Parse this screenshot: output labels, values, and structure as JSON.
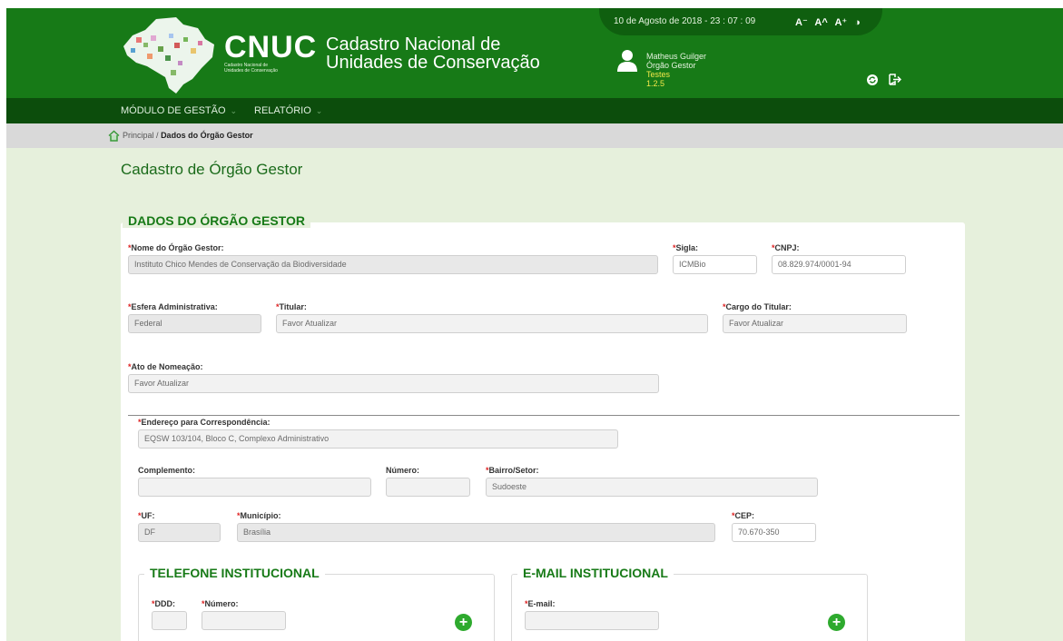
{
  "header": {
    "logo_text": "CNUC",
    "logo_subtitle_1": "Cadastro Nacional de",
    "logo_subtitle_2": "Unidades de Conservação",
    "app_title_line1": "Cadastro Nacional de",
    "app_title_line2": "Unidades de Conservação",
    "datetime": "10 de Agosto de 2018 - 23 : 07 : 09",
    "font_controls": [
      "A⁻",
      "A^",
      "A⁺",
      "◑"
    ],
    "user": {
      "name": "Matheus Guilger",
      "role": "Órgão Gestor",
      "env": "Testes",
      "version": "1.2.5"
    },
    "icons": {
      "refresh": "refresh-icon",
      "logout": "logout-icon",
      "user": "user-icon",
      "home": "home-icon"
    }
  },
  "menu": {
    "items": [
      "MÓDULO DE GESTÃO",
      "RELATÓRIO"
    ]
  },
  "breadcrumb": {
    "home": "Principal",
    "sep": "/",
    "current": "Dados do Órgão Gestor"
  },
  "page": {
    "title": "Cadastro de Órgão Gestor"
  },
  "form": {
    "section_title": "DADOS DO ÓRGÃO GESTOR",
    "nome_label": "Nome do Órgão Gestor:",
    "nome_value": "Instituto Chico Mendes de Conservação da Biodiversidade",
    "sigla_label": "Sigla:",
    "sigla_value": "ICMBio",
    "cnpj_label": "CNPJ:",
    "cnpj_value": "08.829.974/0001-94",
    "esfera_label": "Esfera Administrativa:",
    "esfera_value": "Federal",
    "titular_label": "Titular:",
    "titular_value": "Favor Atualizar",
    "cargo_label": "Cargo do Titular:",
    "cargo_value": "Favor Atualizar",
    "ato_label": "Ato de Nomeação:",
    "ato_value": "Favor Atualizar",
    "endereco_label": "Endereço para Correspondência:",
    "endereco_value": "EQSW 103/104, Bloco C, Complexo Administrativo",
    "complemento_label": "Complemento:",
    "complemento_value": "",
    "numero_label": "Número:",
    "numero_value": "",
    "bairro_label": "Bairro/Setor:",
    "bairro_value": "Sudoeste",
    "uf_label": "UF:",
    "uf_value": "DF",
    "municipio_label": "Município:",
    "municipio_value": "Brasília",
    "cep_label": "CEP:",
    "cep_value": "70.670-350",
    "required_mark": "*"
  },
  "telefone": {
    "title": "TELEFONE INSTITUCIONAL",
    "ddd_label": "DDD:",
    "numero_label": "Número:",
    "add": "+"
  },
  "email": {
    "title": "E-MAIL INSTITUCIONAL",
    "email_label": "E-mail:",
    "add": "+"
  },
  "colors": {
    "header_green": "#177a17",
    "menu_green": "#0c4d0c",
    "page_bg": "#e6f0dc",
    "required": "#dd2222",
    "title_green": "#1b6b1b",
    "add_button": "#2eaa2e"
  }
}
